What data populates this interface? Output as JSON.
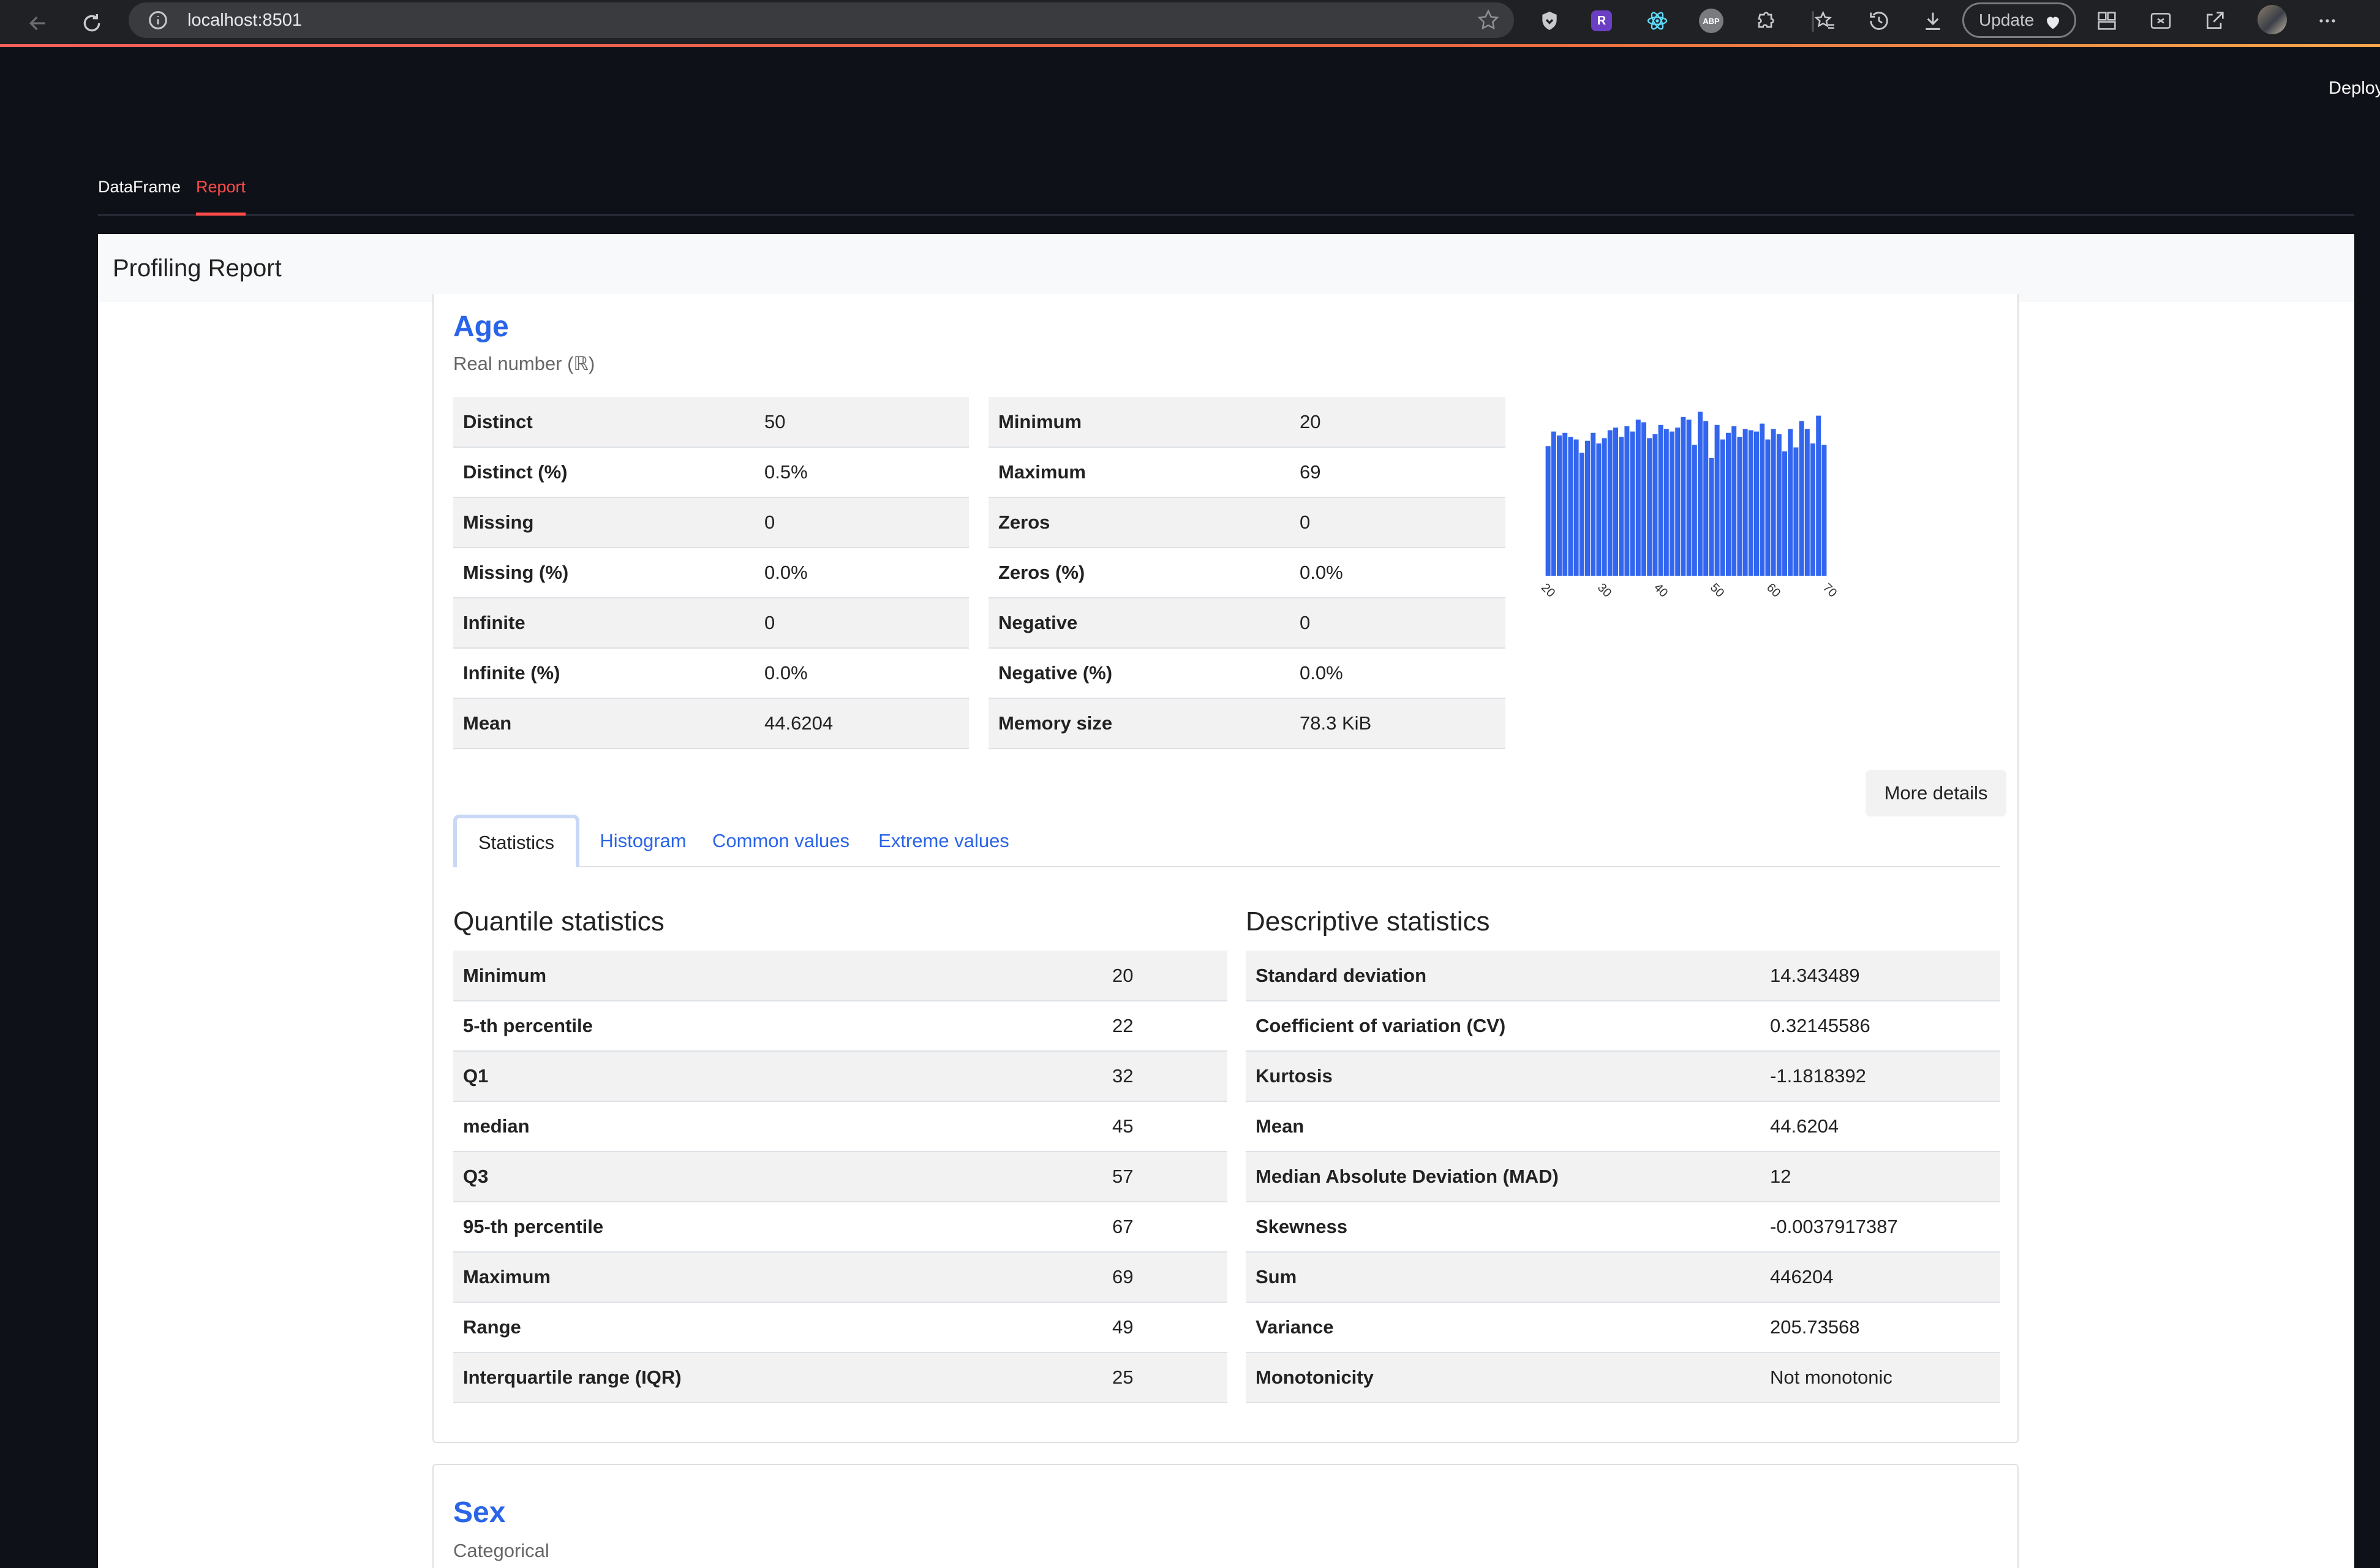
{
  "browser": {
    "url": "localhost:8501",
    "update_label": "Update",
    "extensions": [
      "shield-icon",
      "r-extension-icon",
      "react-icon",
      "abp-icon",
      "puzzle-icon",
      "bookmarks-icon",
      "history-icon",
      "download-icon"
    ],
    "r_ext_label": "R",
    "abp_label": "ABP"
  },
  "app": {
    "deploy_label": "Deploy",
    "tabs": [
      {
        "label": "DataFrame",
        "active": false
      },
      {
        "label": "Report",
        "active": true
      }
    ]
  },
  "report": {
    "title": "Profiling Report",
    "age": {
      "name": "Age",
      "type": "Real number (ℝ)",
      "stats_left": [
        {
          "k": "Distinct",
          "v": "50"
        },
        {
          "k": "Distinct (%)",
          "v": "0.5%"
        },
        {
          "k": "Missing",
          "v": "0"
        },
        {
          "k": "Missing (%)",
          "v": "0.0%"
        },
        {
          "k": "Infinite",
          "v": "0"
        },
        {
          "k": "Infinite (%)",
          "v": "0.0%"
        },
        {
          "k": "Mean",
          "v": "44.6204"
        }
      ],
      "stats_right": [
        {
          "k": "Minimum",
          "v": "20"
        },
        {
          "k": "Maximum",
          "v": "69"
        },
        {
          "k": "Zeros",
          "v": "0"
        },
        {
          "k": "Zeros (%)",
          "v": "0.0%"
        },
        {
          "k": "Negative",
          "v": "0"
        },
        {
          "k": "Negative (%)",
          "v": "0.0%"
        },
        {
          "k": "Memory size",
          "v": "78.3 KiB"
        }
      ],
      "more_details_label": "More details",
      "subtabs": [
        {
          "label": "Statistics",
          "active": true
        },
        {
          "label": "Histogram",
          "active": false
        },
        {
          "label": "Common values",
          "active": false
        },
        {
          "label": "Extreme values",
          "active": false
        }
      ],
      "quantile_title": "Quantile statistics",
      "quantile": [
        {
          "k": "Minimum",
          "v": "20"
        },
        {
          "k": "5-th percentile",
          "v": "22"
        },
        {
          "k": "Q1",
          "v": "32"
        },
        {
          "k": "median",
          "v": "45"
        },
        {
          "k": "Q3",
          "v": "57"
        },
        {
          "k": "95-th percentile",
          "v": "67"
        },
        {
          "k": "Maximum",
          "v": "69"
        },
        {
          "k": "Range",
          "v": "49"
        },
        {
          "k": "Interquartile range (IQR)",
          "v": "25"
        }
      ],
      "descriptive_title": "Descriptive statistics",
      "descriptive": [
        {
          "k": "Standard deviation",
          "v": "14.343489"
        },
        {
          "k": "Coefficient of variation (CV)",
          "v": "0.32145586"
        },
        {
          "k": "Kurtosis",
          "v": "-1.1818392"
        },
        {
          "k": "Mean",
          "v": "44.6204"
        },
        {
          "k": "Median Absolute Deviation (MAD)",
          "v": "12"
        },
        {
          "k": "Skewness",
          "v": "-0.0037917387"
        },
        {
          "k": "Sum",
          "v": "446204"
        },
        {
          "k": "Variance",
          "v": "205.73568"
        },
        {
          "k": "Monotonicity",
          "v": "Not monotonic"
        }
      ]
    },
    "sex": {
      "name": "Sex",
      "type": "Categorical"
    }
  },
  "chart_data": {
    "type": "bar",
    "title": "",
    "xlabel": "",
    "ylabel": "",
    "bar_color": "#3366ee",
    "x": [
      20,
      21,
      22,
      23,
      24,
      25,
      26,
      27,
      28,
      29,
      30,
      31,
      32,
      33,
      34,
      35,
      36,
      37,
      38,
      39,
      40,
      41,
      42,
      43,
      44,
      45,
      46,
      47,
      48,
      49,
      50,
      51,
      52,
      53,
      54,
      55,
      56,
      57,
      58,
      59,
      60,
      61,
      62,
      63,
      64,
      65,
      66,
      67,
      68,
      69
    ],
    "values": [
      196,
      218,
      212,
      216,
      210,
      206,
      186,
      204,
      216,
      200,
      208,
      220,
      224,
      210,
      226,
      218,
      236,
      232,
      208,
      214,
      228,
      222,
      218,
      224,
      240,
      236,
      198,
      248,
      234,
      178,
      228,
      206,
      216,
      226,
      210,
      222,
      220,
      218,
      230,
      206,
      222,
      214,
      188,
      222,
      194,
      234,
      222,
      200,
      242,
      198
    ],
    "x_ticks": [
      "20",
      "30",
      "40",
      "50",
      "60",
      "70"
    ],
    "xlim": [
      19.5,
      69.5
    ],
    "ylim": [
      0,
      250
    ],
    "grid": false
  }
}
